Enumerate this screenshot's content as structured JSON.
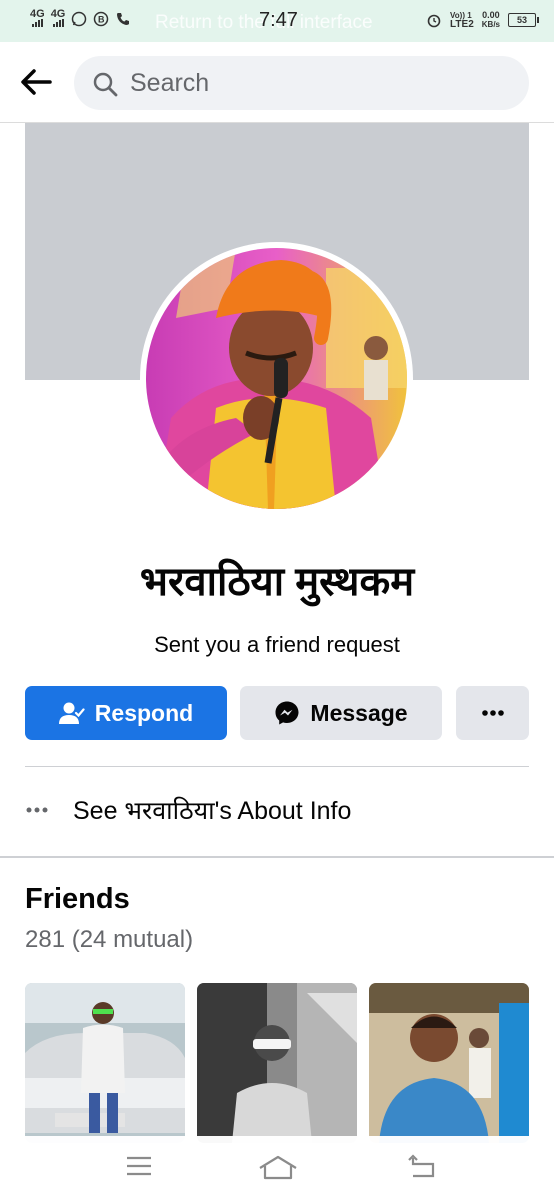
{
  "status_bar": {
    "network1": "4G",
    "network2": "4G",
    "overlay_text": "Return to the full interface",
    "time": "7:47",
    "volte": "Vo)) 1",
    "lte": "LTE2",
    "speed_value": "0.00",
    "speed_unit": "KB/s",
    "battery": "53"
  },
  "search": {
    "placeholder": "Search"
  },
  "profile": {
    "name": "भरवाठिया मुस्थकम",
    "subtitle": "Sent you a friend request"
  },
  "actions": {
    "respond_label": "Respond",
    "message_label": "Message"
  },
  "about": {
    "label": "See भरवाठिया's About Info"
  },
  "friends": {
    "title": "Friends",
    "count": "281 (24 mutual)"
  },
  "icons": [
    "back-arrow-icon",
    "search-icon",
    "add-friend-icon",
    "messenger-icon",
    "more-icon",
    "ellipsis-icon",
    "menu-icon",
    "home-icon",
    "back-nav-icon"
  ],
  "colors": {
    "accent": "#1b74e4",
    "secondary_button": "#e4e6eb",
    "cover": "#c9ccd1",
    "status_bar": "#e3f4ec"
  }
}
